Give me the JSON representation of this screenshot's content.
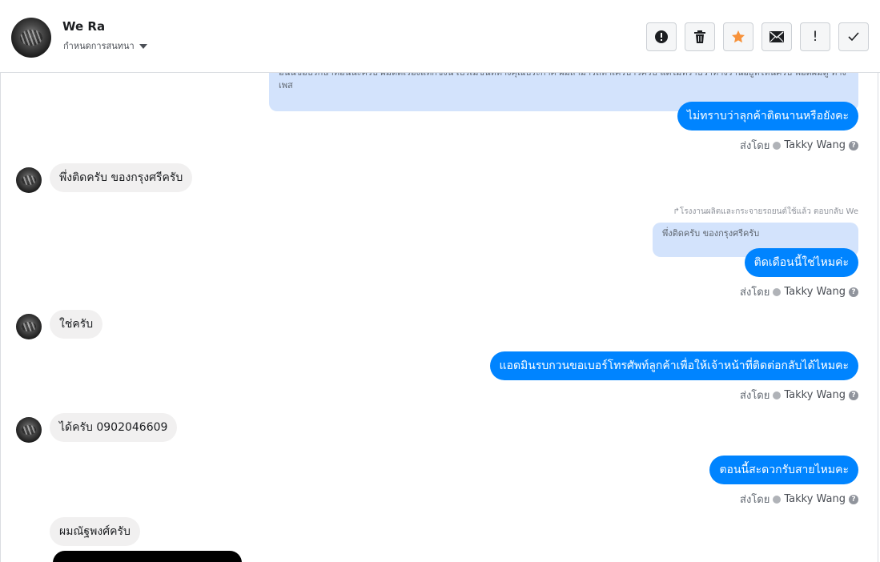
{
  "header": {
    "contact_name": "We Ra",
    "assign_label": "กำหนดการสนทนา",
    "toolbar": [
      {
        "name": "spam-button",
        "icon": "alert-circle-icon"
      },
      {
        "name": "delete-button",
        "icon": "trash-icon"
      },
      {
        "name": "star-button",
        "icon": "star-icon",
        "color": "#f7923b"
      },
      {
        "name": "mark-unread-button",
        "icon": "envelope-icon"
      },
      {
        "name": "follow-up-button",
        "icon": "exclamation-icon",
        "text": "!"
      },
      {
        "name": "mark-done-button",
        "icon": "checkmark-icon"
      }
    ]
  },
  "thread": {
    "top_quote": "อนนขอบรกษาทอนนะครบ ผมตดเรองแทกซงน เบรเมขนททางคุณประกาศ ผมสามารถทาเครบาวครบ แตไมทราบวาทางรานอยูทไหนครบ พอดผมดู ทางเพส",
    "messages": [
      {
        "id": "m1",
        "text": "ไม่ทราบว่าลุกค้าติดนานหรือยังคะ",
        "sent_by_label": "ส่งโดย",
        "agent": "Takky Wang"
      },
      {
        "id": "m2",
        "text": "พึ่งติดครับ ของกรุงศรีครับ"
      },
      {
        "id": "m3",
        "reply_line": "↱โรงงานผลิตและกระจายรถยนต์ใช้แล้ว ตอบกลับ We",
        "quote": "พึ่งติดครับ ของกรุงศรีครับ",
        "text": "ติดเดือนนี้ใช่ไหมค่ะ",
        "sent_by_label": "ส่งโดย",
        "agent": "Takky Wang"
      },
      {
        "id": "m4",
        "text": "ใช่ครับ"
      },
      {
        "id": "m5",
        "text": "แอดมินรบกวนขอเบอร์โทรศัพท์ลูกค้าเพื่อให้เจ้าหน้าที่ติดต่อกลับได้ไหมคะ",
        "sent_by_label": "ส่งโดย",
        "agent": "Takky Wang"
      },
      {
        "id": "m6",
        "text": "ได้ครับ 0902046609"
      },
      {
        "id": "m7",
        "text": "ตอนนี้สะดวกรับสายไหมคะ",
        "sent_by_label": "ส่งโดย",
        "agent": "Takky Wang"
      },
      {
        "id": "m8",
        "text": "ผมณัฐพงศ์ครับ"
      }
    ]
  },
  "colors": {
    "outgoing": "#0084ff",
    "incoming": "#f1f0f0",
    "quote": "#d3e3fc"
  }
}
